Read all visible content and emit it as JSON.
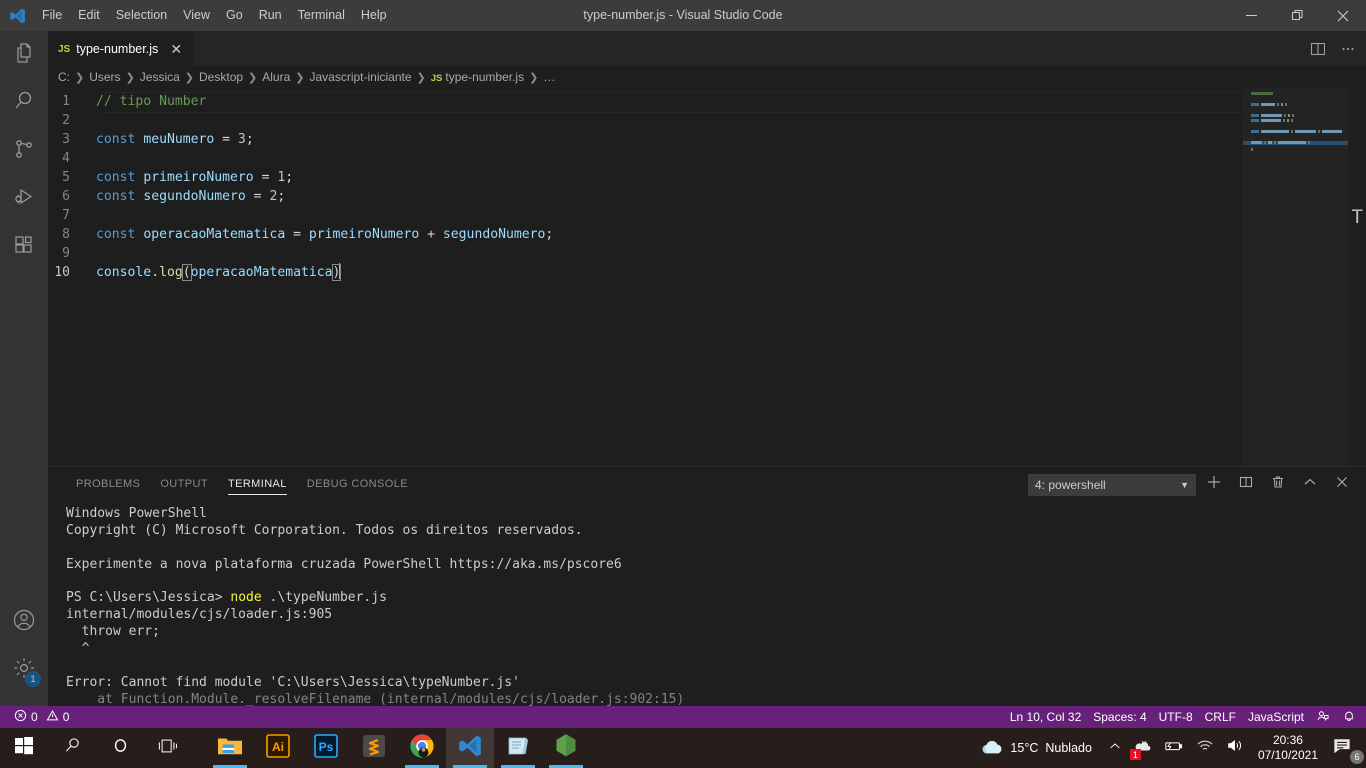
{
  "window": {
    "title": "type-number.js - Visual Studio Code",
    "logo_icon": "vscode-logo-icon",
    "controls": {
      "minimize_icon": "minimize-icon",
      "maximize_icon": "maximize-restore-icon",
      "close_icon": "close-icon"
    }
  },
  "menubar": {
    "items": [
      {
        "label": "File"
      },
      {
        "label": "Edit"
      },
      {
        "label": "Selection"
      },
      {
        "label": "View"
      },
      {
        "label": "Go"
      },
      {
        "label": "Run"
      },
      {
        "label": "Terminal"
      },
      {
        "label": "Help"
      }
    ]
  },
  "activitybar": {
    "items": [
      {
        "name": "explorer",
        "icon": "files-icon"
      },
      {
        "name": "search",
        "icon": "search-icon"
      },
      {
        "name": "source-control",
        "icon": "source-control-branch-icon"
      },
      {
        "name": "run-and-debug",
        "icon": "run-debug-icon"
      },
      {
        "name": "extensions",
        "icon": "extensions-icon"
      }
    ],
    "bottom_items": [
      {
        "name": "accounts",
        "icon": "account-circle-icon",
        "badge": ""
      },
      {
        "name": "manage-settings",
        "icon": "gear-icon",
        "badge": "1"
      }
    ]
  },
  "editor": {
    "tab": {
      "file_type": "JS",
      "label": "type-number.js",
      "close_icon": "close-icon"
    },
    "tab_actions": [
      {
        "name": "split-editor",
        "icon": "split-editor-icon"
      },
      {
        "name": "more-actions",
        "icon": "ellipsis-icon"
      }
    ],
    "breadcrumbs": [
      {
        "label": "C:"
      },
      {
        "label": "Users"
      },
      {
        "label": "Jessica"
      },
      {
        "label": "Desktop"
      },
      {
        "label": "Alura"
      },
      {
        "label": "Javascript-iniciante"
      },
      {
        "label": "type-number.js",
        "file_type": "JS"
      },
      {
        "label": "…"
      }
    ],
    "lines": [
      {
        "n": "1",
        "tokens": [
          {
            "t": "comment",
            "v": "// tipo Number"
          }
        ]
      },
      {
        "n": "2",
        "tokens": []
      },
      {
        "n": "3",
        "tokens": [
          {
            "t": "kw",
            "v": "const"
          },
          {
            "t": "op",
            "v": " "
          },
          {
            "t": "var",
            "v": "meuNumero"
          },
          {
            "t": "op",
            "v": " = "
          },
          {
            "t": "num",
            "v": "3"
          },
          {
            "t": "punc",
            "v": ";"
          }
        ]
      },
      {
        "n": "4",
        "tokens": []
      },
      {
        "n": "5",
        "tokens": [
          {
            "t": "kw",
            "v": "const"
          },
          {
            "t": "op",
            "v": " "
          },
          {
            "t": "var",
            "v": "primeiroNumero"
          },
          {
            "t": "op",
            "v": " = "
          },
          {
            "t": "num",
            "v": "1"
          },
          {
            "t": "punc",
            "v": ";"
          }
        ]
      },
      {
        "n": "6",
        "tokens": [
          {
            "t": "kw",
            "v": "const"
          },
          {
            "t": "op",
            "v": " "
          },
          {
            "t": "var",
            "v": "segundoNumero"
          },
          {
            "t": "op",
            "v": " = "
          },
          {
            "t": "num",
            "v": "2"
          },
          {
            "t": "punc",
            "v": ";"
          }
        ]
      },
      {
        "n": "7",
        "tokens": []
      },
      {
        "n": "8",
        "tokens": [
          {
            "t": "kw",
            "v": "const"
          },
          {
            "t": "op",
            "v": " "
          },
          {
            "t": "var",
            "v": "operacaoMatematica"
          },
          {
            "t": "op",
            "v": " = "
          },
          {
            "t": "var",
            "v": "primeiroNumero"
          },
          {
            "t": "op",
            "v": " + "
          },
          {
            "t": "var",
            "v": "segundoNumero"
          },
          {
            "t": "punc",
            "v": ";"
          }
        ]
      },
      {
        "n": "9",
        "tokens": []
      },
      {
        "n": "10",
        "current": true,
        "tokens": [
          {
            "t": "var",
            "v": "console"
          },
          {
            "t": "punc",
            "v": "."
          },
          {
            "t": "fn",
            "v": "log"
          },
          {
            "t": "bracket",
            "v": "("
          },
          {
            "t": "var",
            "v": "operacaoMatematica"
          },
          {
            "t": "bracket",
            "v": ")"
          },
          {
            "t": "caret",
            "v": ""
          }
        ]
      }
    ],
    "right_glyph": "T"
  },
  "panel": {
    "tabs": [
      {
        "label": "PROBLEMS",
        "active": false
      },
      {
        "label": "OUTPUT",
        "active": false
      },
      {
        "label": "TERMINAL",
        "active": true
      },
      {
        "label": "DEBUG CONSOLE",
        "active": false
      }
    ],
    "terminal_selector": {
      "value": "4: powershell",
      "caret_icon": "chevron-down-icon"
    },
    "actions": [
      {
        "name": "new-terminal",
        "icon": "plus-icon"
      },
      {
        "name": "split-terminal",
        "icon": "split-icon"
      },
      {
        "name": "kill-terminal",
        "icon": "trash-icon"
      },
      {
        "name": "maximize-panel",
        "icon": "chevron-up-icon"
      },
      {
        "name": "close-panel",
        "icon": "close-icon"
      }
    ],
    "terminal_lines": [
      [
        {
          "c": "default",
          "v": "Windows PowerShell"
        }
      ],
      [
        {
          "c": "default",
          "v": "Copyright (C) Microsoft Corporation. Todos os direitos reservados."
        }
      ],
      [
        {
          "c": "default",
          "v": ""
        }
      ],
      [
        {
          "c": "default",
          "v": "Experimente a nova plataforma cruzada PowerShell https://aka.ms/pscore6"
        }
      ],
      [
        {
          "c": "default",
          "v": ""
        }
      ],
      [
        {
          "c": "default",
          "v": "PS C:\\Users\\Jessica> "
        },
        {
          "c": "yellow",
          "v": "node"
        },
        {
          "c": "default",
          "v": " .\\typeNumber.js"
        }
      ],
      [
        {
          "c": "default",
          "v": "internal/modules/cjs/loader.js:905"
        }
      ],
      [
        {
          "c": "default",
          "v": "  throw err;"
        }
      ],
      [
        {
          "c": "default",
          "v": "  ^"
        }
      ],
      [
        {
          "c": "default",
          "v": ""
        }
      ],
      [
        {
          "c": "default",
          "v": "Error: Cannot find module 'C:\\Users\\Jessica\\typeNumber.js'"
        }
      ],
      [
        {
          "c": "dim",
          "v": "    at Function.Module._resolveFilename (internal/modules/cjs/loader.js:902:15)"
        }
      ]
    ]
  },
  "statusbar": {
    "left": [
      {
        "name": "errors-warnings",
        "icon": "error-warning-icon",
        "errors": "0",
        "warnings": "0"
      }
    ],
    "right": [
      {
        "name": "cursor-position",
        "label": "Ln 10, Col 32"
      },
      {
        "name": "indentation",
        "label": "Spaces: 4"
      },
      {
        "name": "encoding",
        "label": "UTF-8"
      },
      {
        "name": "eol",
        "label": "CRLF"
      },
      {
        "name": "language-mode",
        "label": "JavaScript"
      },
      {
        "name": "live-share",
        "icon": "live-share-icon",
        "label": ""
      },
      {
        "name": "notifications",
        "icon": "bell-icon",
        "label": ""
      }
    ],
    "accent_color": "#68217a"
  },
  "taskbar": {
    "system_buttons": [
      {
        "name": "start",
        "icon": "windows-logo-icon"
      },
      {
        "name": "search",
        "icon": "search-icon"
      },
      {
        "name": "cortana",
        "icon": "cortana-circle-icon"
      },
      {
        "name": "task-view",
        "icon": "task-view-icon"
      }
    ],
    "apps": [
      {
        "name": "file-explorer",
        "icon": "folder-icon",
        "running": true,
        "active": false
      },
      {
        "name": "adobe-illustrator",
        "icon": "illustrator-ai-icon",
        "running": false,
        "active": false
      },
      {
        "name": "adobe-photoshop",
        "icon": "photoshop-ps-icon",
        "running": false,
        "active": false
      },
      {
        "name": "sublime-text",
        "icon": "sublime-text-icon",
        "running": false,
        "active": false
      },
      {
        "name": "google-chrome",
        "icon": "chrome-icon",
        "running": true,
        "active": false
      },
      {
        "name": "visual-studio-code",
        "icon": "vscode-icon",
        "running": true,
        "active": true
      },
      {
        "name": "sticky-notes",
        "icon": "sticky-notes-icon",
        "running": true,
        "active": false
      },
      {
        "name": "node-js",
        "icon": "nodejs-hexagon-icon",
        "running": true,
        "active": false
      }
    ],
    "tray": {
      "weather": {
        "icon": "cloud-icon",
        "temperature": "15°C",
        "condition": "Nublado"
      },
      "icons": [
        {
          "name": "show-hidden-icons",
          "icon": "chevron-up-icon"
        },
        {
          "name": "onedrive-updates",
          "icon": "onedrive-icon",
          "badge": "1"
        },
        {
          "name": "battery",
          "icon": "battery-icon"
        },
        {
          "name": "network",
          "icon": "wifi-icon"
        },
        {
          "name": "volume",
          "icon": "speaker-icon"
        }
      ],
      "clock": {
        "time": "20:36",
        "date": "07/10/2021"
      },
      "notifications": {
        "icon": "action-center-icon",
        "count": "6"
      }
    }
  }
}
